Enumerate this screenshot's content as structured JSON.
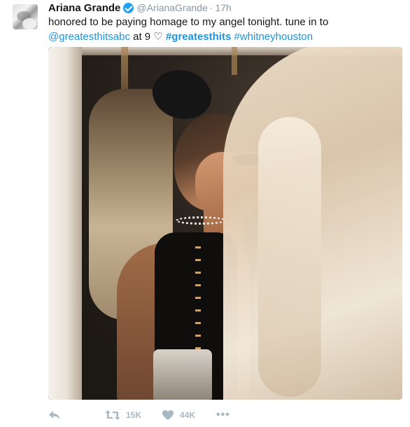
{
  "tweet": {
    "name": "Ariana Grande",
    "handle": "@ArianaGrande",
    "separator": "·",
    "time": "17h",
    "text_part1": "honored to be paying homage to my angel tonight. tune in to ",
    "mention": "@greatesthitsabc",
    "text_part2": " at 9 ♡ ",
    "hashtag1": "#greatesthits",
    "hashtag2": "#whitneyhouston",
    "actions": {
      "retweets": "15K",
      "likes": "44K",
      "more": "•••"
    },
    "icons": {
      "verified": "verified-badge-icon",
      "reply": "reply-icon",
      "retweet": "retweet-icon",
      "like": "heart-icon",
      "more": "more-icon"
    },
    "colors": {
      "link": "#1b95e0",
      "muted": "#8899a6",
      "verified": "#1da1f2",
      "action": "#aab8c2"
    }
  }
}
